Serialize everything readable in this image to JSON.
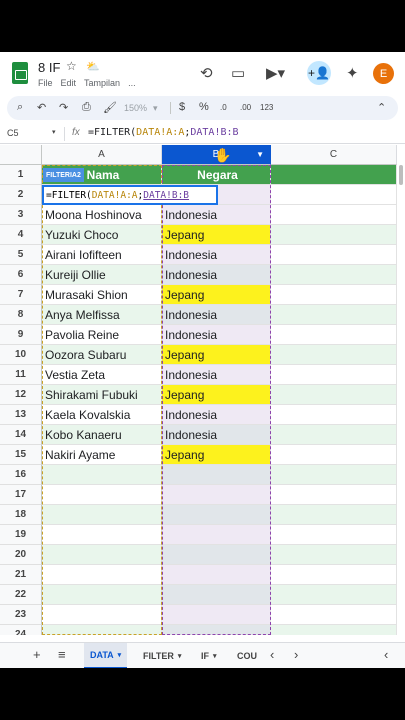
{
  "header": {
    "title": "8 IF",
    "menu": [
      "File",
      "Edit",
      "Tampilan",
      "..."
    ],
    "avatar_initial": "E"
  },
  "toolbar": {
    "zoom": "150%",
    "currency": "$",
    "percent": "%",
    "decrease_decimal": ".0",
    "increase_decimal": ".00",
    "number_format": "123"
  },
  "formula_bar": {
    "cell_ref": "C5",
    "prefix": "=FILTER(",
    "ref_a": "DATA!A:A",
    "separator": ";",
    "ref_b": "DATA!B:B"
  },
  "columns": [
    "A",
    "B",
    "C"
  ],
  "header_row": {
    "nama": "Nama",
    "negara": "Negara"
  },
  "filter_tag": "FILTERIA2",
  "editing_formula": {
    "prefix": "=FILTER(",
    "ref_a": "DATA!A:A",
    "separator": ";",
    "ref_b": "DATA!B:B"
  },
  "rows": [
    {
      "num": "1"
    },
    {
      "num": "2"
    },
    {
      "num": "3",
      "name": "Moona Hoshinova",
      "country": "Indonesia"
    },
    {
      "num": "4",
      "name": "Yuzuki Choco",
      "country": "Jepang"
    },
    {
      "num": "5",
      "name": "Airani Iofifteen",
      "country": "Indonesia"
    },
    {
      "num": "6",
      "name": "Kureiji Ollie",
      "country": "Indonesia"
    },
    {
      "num": "7",
      "name": "Murasaki Shion",
      "country": "Jepang"
    },
    {
      "num": "8",
      "name": "Anya Melfissa",
      "country": "Indonesia"
    },
    {
      "num": "9",
      "name": "Pavolia Reine",
      "country": "Indonesia"
    },
    {
      "num": "10",
      "name": "Oozora Subaru",
      "country": "Jepang"
    },
    {
      "num": "11",
      "name": "Vestia Zeta",
      "country": "Indonesia"
    },
    {
      "num": "12",
      "name": "Shirakami Fubuki",
      "country": "Jepang"
    },
    {
      "num": "13",
      "name": "Kaela Kovalskia",
      "country": "Indonesia"
    },
    {
      "num": "14",
      "name": "Kobo Kanaeru",
      "country": "Indonesia"
    },
    {
      "num": "15",
      "name": "Nakiri Ayame",
      "country": "Jepang"
    },
    {
      "num": "16"
    },
    {
      "num": "17"
    },
    {
      "num": "18"
    },
    {
      "num": "19"
    },
    {
      "num": "20"
    },
    {
      "num": "21"
    },
    {
      "num": "22"
    },
    {
      "num": "23"
    },
    {
      "num": "24"
    }
  ],
  "highlight_value": "Jepang",
  "highlight_color": "#fdf21d",
  "sheet_tabs": [
    "DATA",
    "FILTER",
    "IF",
    "COU"
  ],
  "active_tab": "DATA"
}
